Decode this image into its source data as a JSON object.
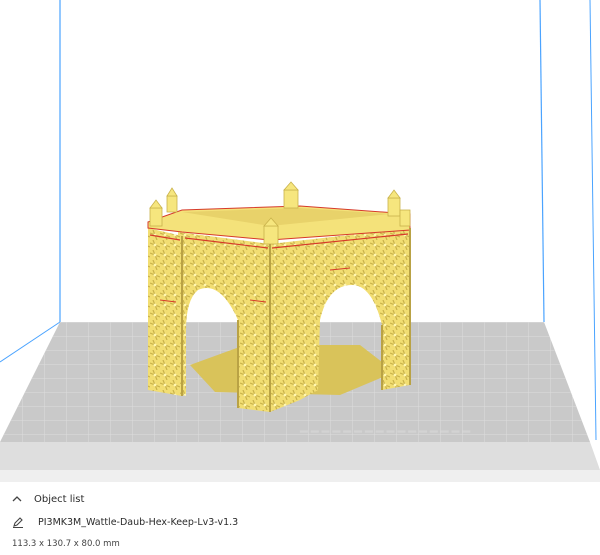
{
  "object_list": {
    "header_label": "Object list",
    "file_name": "PI3MK3M_Wattle-Daub-Hex-Keep-Lv3-v1.3",
    "dimensions": "113.3 x 130.7 x 80.0 mm"
  },
  "colors": {
    "model": "#f4e27a",
    "model_shadow": "#c9b24b",
    "model_edge": "#d63a2a",
    "build_plate": "#c8c8c8",
    "plate_grid": "#e6e6e6",
    "volume_edge": "#4aa3ff"
  },
  "icons": {
    "collapse": "chevron-up-icon",
    "edit": "pencil-icon"
  }
}
